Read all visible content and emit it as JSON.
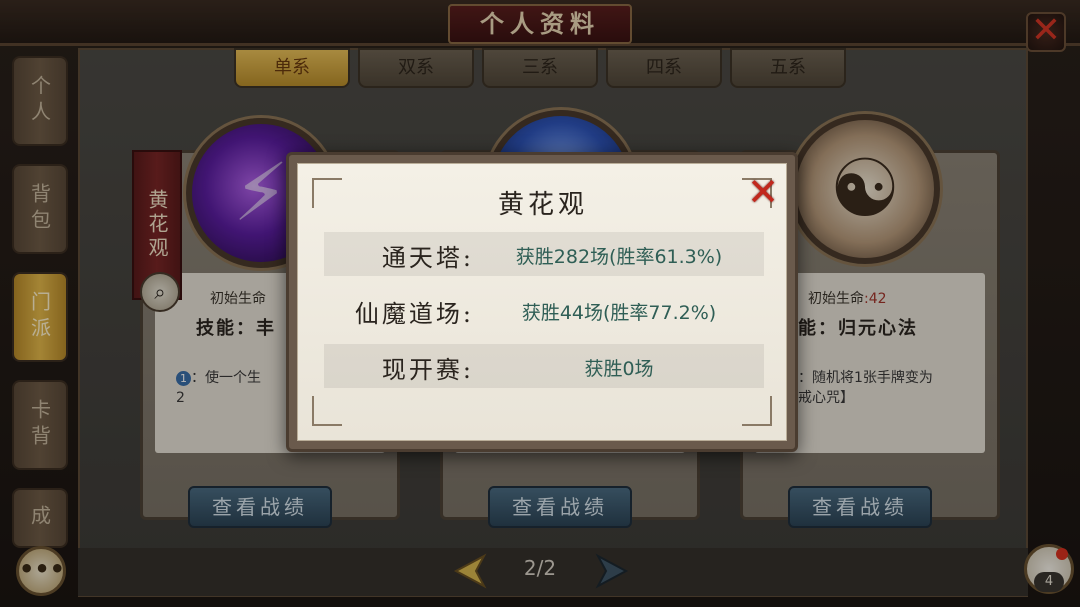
{
  "header": {
    "title": "个人资料",
    "close_symbol": "✕"
  },
  "side_tabs": [
    "个人",
    "背包",
    "门派",
    "卡背",
    "成"
  ],
  "top_tabs": [
    "单系",
    "双系",
    "三系",
    "四系",
    "五系"
  ],
  "cards": [
    {
      "sect": "黄花观",
      "life_label": "初始生命",
      "skill_label": "技能：丰",
      "desc_num": "1",
      "desc": "：使一个生",
      "desc2": "2",
      "button": "查看战绩",
      "orb": "purple"
    },
    {
      "button": "查看战绩",
      "orb": "blue"
    },
    {
      "life_label": "初始生命",
      "life_value": ":42",
      "skill_label": "能：归元心法",
      "desc": "：随机将1张手牌变为",
      "desc2": "戒心咒】",
      "button": "查看战绩",
      "orb": "taiji"
    }
  ],
  "pagination": {
    "text": "2/2"
  },
  "chat_icon": "chat-bubble-icon",
  "notification_count": "4",
  "popup": {
    "title": "黄花观",
    "close_symbol": "✕",
    "rows": [
      {
        "label": "通天塔:",
        "value": "获胜282场(胜率61.3%)"
      },
      {
        "label": "仙魔道场:",
        "value": "获胜44场(胜率77.2%)"
      },
      {
        "label": "现开赛:",
        "value": "获胜0场"
      }
    ]
  },
  "colors": {
    "accent_gold": "#e3b84a",
    "popup_value": "#2f5e55",
    "close_red": "#c2281d"
  }
}
